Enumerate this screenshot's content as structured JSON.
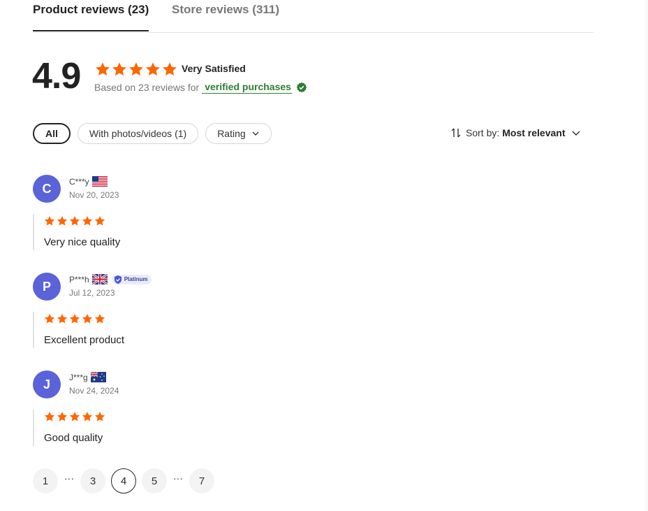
{
  "tabs": {
    "product": "Product reviews (23)",
    "store": "Store reviews (311)"
  },
  "summary": {
    "score": "4.9",
    "satisfaction": "Very Satisfied",
    "based_on": "Based on 23 reviews for",
    "verified": "verified purchases",
    "stars": 5
  },
  "filters": {
    "all": "All",
    "photos": "With photos/videos (1)",
    "rating": "Rating"
  },
  "sort": {
    "label": "Sort by:",
    "value": "Most relevant"
  },
  "reviews": [
    {
      "initial": "C",
      "name": "C***y",
      "flag": "us-flag",
      "date": "Nov 20, 2023",
      "stars": 5,
      "text": "Very nice quality"
    },
    {
      "initial": "P",
      "name": "P***h",
      "flag": "uk-flag",
      "badge": "Platinum",
      "date": "Jul 12, 2023",
      "stars": 5,
      "text": "Excellent product"
    },
    {
      "initial": "J",
      "name": "J***g",
      "flag": "au-flag",
      "date": "Nov 24, 2024",
      "stars": 5,
      "text": "Good quality"
    }
  ],
  "pagination": {
    "pages": [
      "1",
      "3",
      "4",
      "5",
      "7"
    ],
    "current": "4",
    "ellipsis": "···"
  },
  "colors": {
    "star": "#ff6600",
    "avatar": "#5a63d8",
    "verified": "#2e7d32"
  }
}
